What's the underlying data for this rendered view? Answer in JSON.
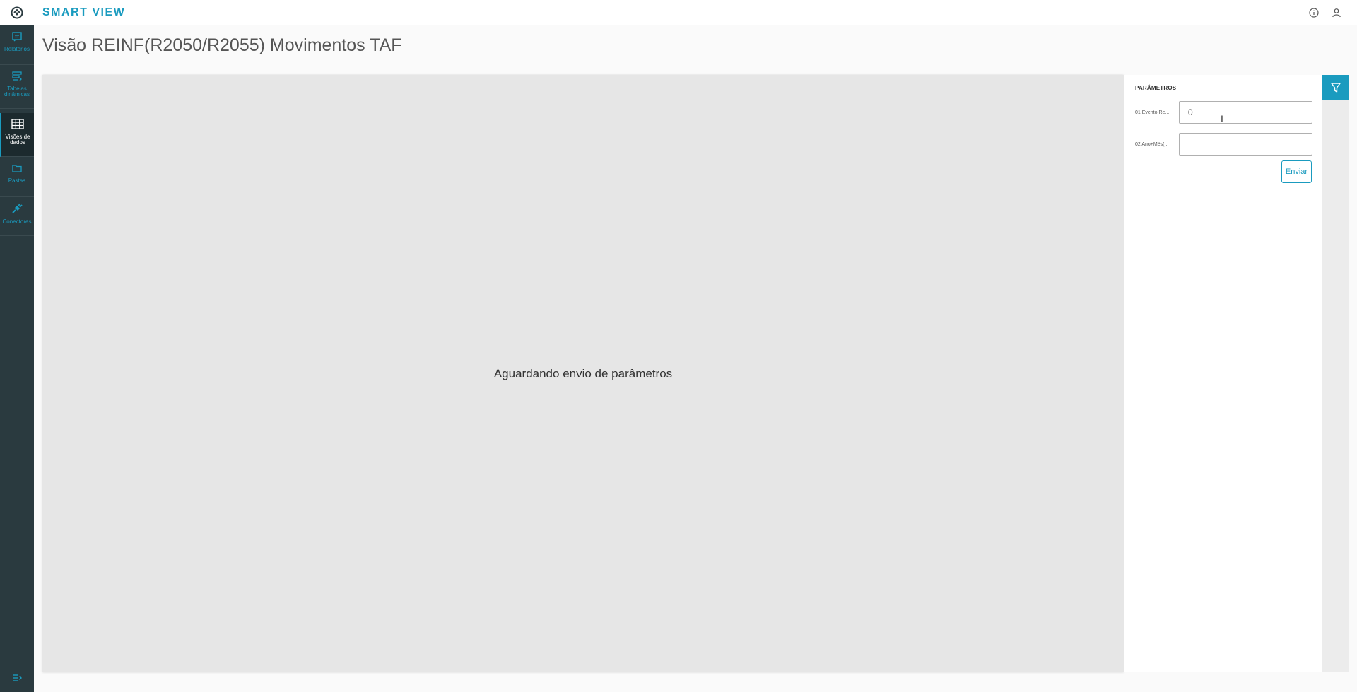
{
  "app": {
    "title": "SMART VIEW"
  },
  "topbar": {
    "info_icon": "info-icon",
    "user_icon": "user-icon"
  },
  "sidebar": {
    "items": [
      {
        "label": "Relatórios",
        "icon": "report-icon",
        "active": false
      },
      {
        "label": "Tabelas dinâmicas",
        "icon": "pivot-table-icon",
        "active": false
      },
      {
        "label": "Visões de dados",
        "icon": "grid-icon",
        "active": true
      },
      {
        "label": "Pastas",
        "icon": "folder-icon",
        "active": false
      },
      {
        "label": "Conectores",
        "icon": "plug-icon",
        "active": false
      }
    ],
    "collapse_icon": "collapse-menu-icon"
  },
  "page": {
    "title": "Visão REINF(R2050/R2055) Movimentos TAF"
  },
  "viewer": {
    "message": "Aguardando envio de parâmetros"
  },
  "params": {
    "title": "PARÂMETROS",
    "fields": [
      {
        "label": "01 Evento Re...",
        "value": "0",
        "placeholder": ""
      },
      {
        "label": "02 Ano+Mês(...",
        "value": "",
        "placeholder": ""
      }
    ],
    "submit_label": "Enviar"
  },
  "colors": {
    "accent": "#1a9bbf",
    "sidebar_bg": "#2a3a3f",
    "viewer_bg": "#e6e6e6"
  }
}
